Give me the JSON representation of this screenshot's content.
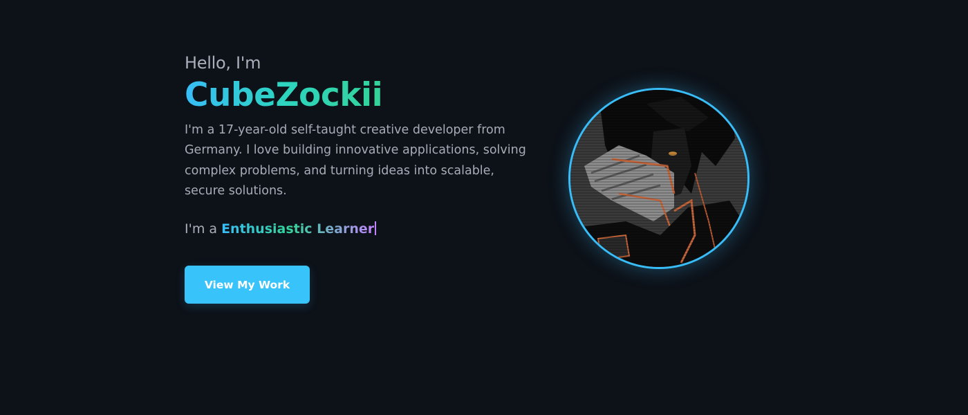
{
  "hero": {
    "greeting": "Hello, I'm",
    "name": "CubeZockii",
    "bio": "I'm a 17-year-old self-taught creative developer from Germany. I love building innovative applications, solving complex problems, and turning ideas into scalable, secure solutions.",
    "typed_prefix": "I'm a ",
    "typed_word": "Enthusiastic Learner",
    "cta_label": "View My Work"
  },
  "avatar": {
    "icon": "anime-character-avatar",
    "ring_color": "#38bdf8"
  },
  "colors": {
    "background": "#0d1118",
    "accent_blue": "#38bdf8",
    "accent_green": "#34d399",
    "accent_purple": "#c084fc",
    "button": "#38c3fb"
  }
}
